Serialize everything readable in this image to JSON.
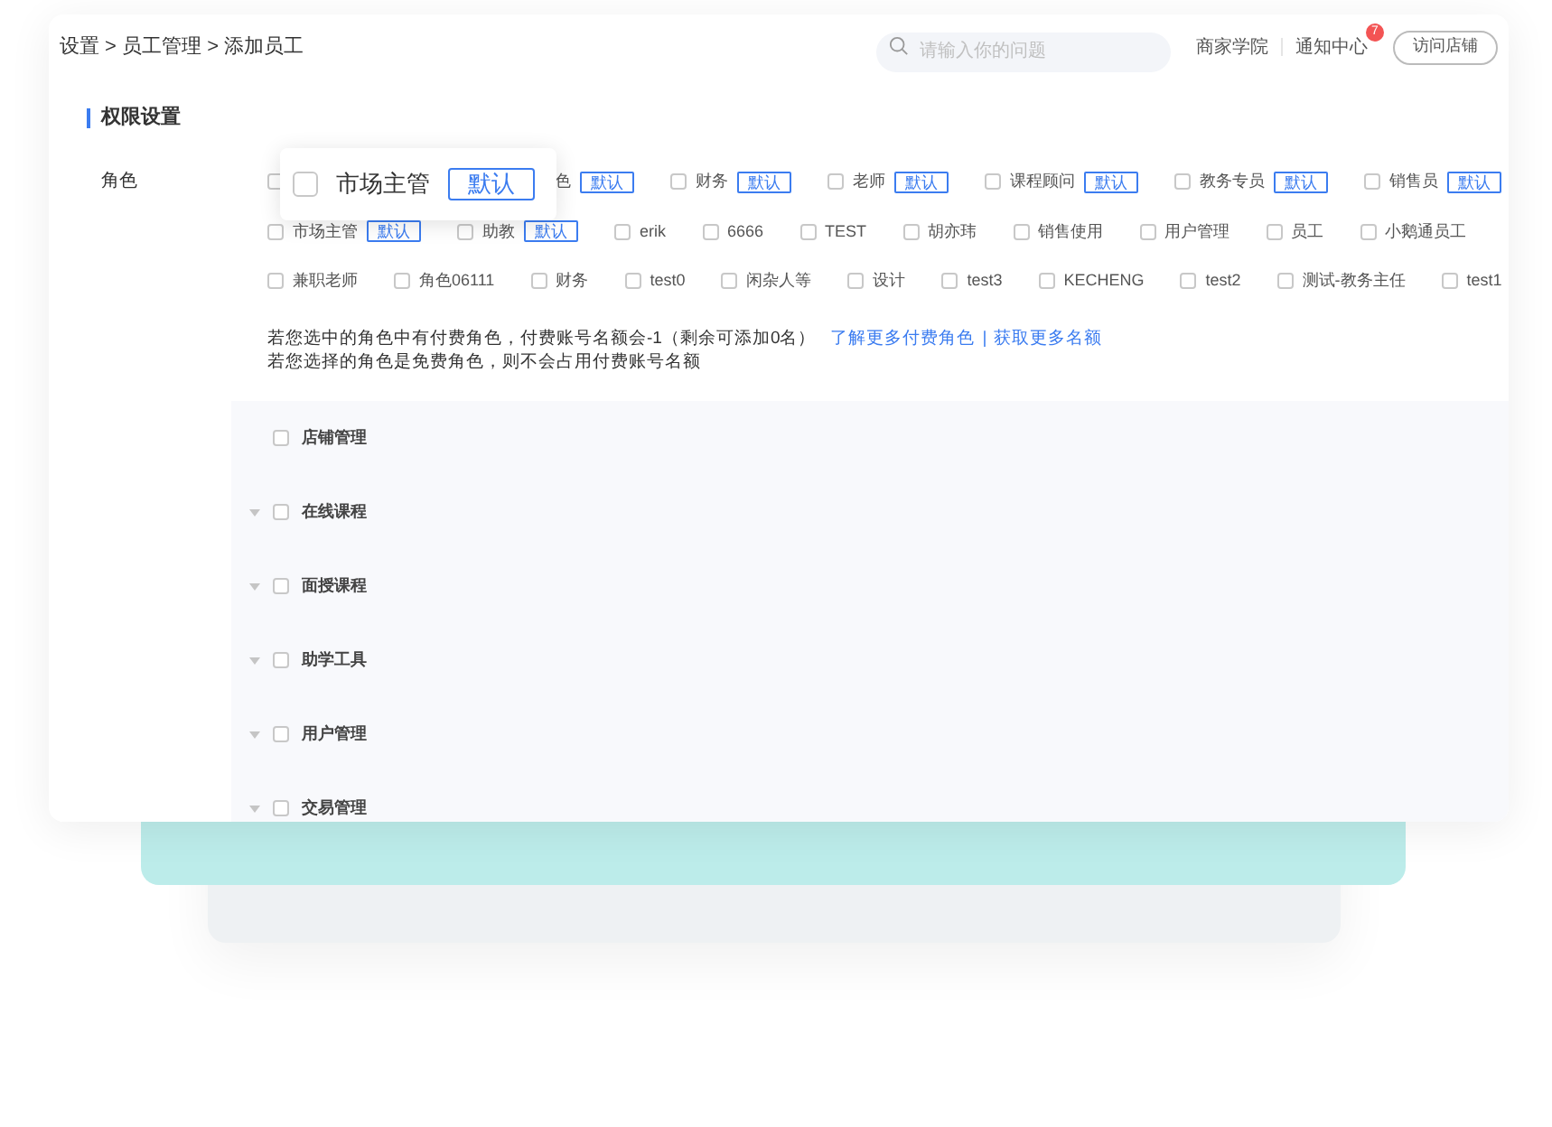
{
  "breadcrumb": "设置 > 员工管理 > 添加员工",
  "search": {
    "placeholder": "请输入你的问题"
  },
  "header_links": [
    {
      "label": "商家学院"
    },
    {
      "label": "通知中心",
      "badge": "7"
    }
  ],
  "visit_button": "访问店铺",
  "section_title": "权限设置",
  "role_label": "角色",
  "roles": [
    [
      {
        "label": "色",
        "tag": "默认"
      },
      {
        "label": "财务",
        "checked": false,
        "tag": "默认"
      },
      {
        "label": "老师",
        "checked": false,
        "tag": "默认"
      },
      {
        "label": "课程顾问",
        "checked": false,
        "tag": "默认"
      },
      {
        "label": "教务专员",
        "checked": false,
        "tag": "默认"
      },
      {
        "label": "销售员",
        "checked": false,
        "tag": "默认"
      }
    ],
    [
      {
        "label": "市场主管",
        "checked": false,
        "tag": "默认"
      },
      {
        "label": "助教",
        "checked": false,
        "tag": "默认"
      },
      {
        "label": "erik",
        "checked": false
      },
      {
        "label": "6666",
        "checked": false
      },
      {
        "label": "TEST",
        "checked": false
      },
      {
        "label": "胡亦玮",
        "checked": false
      },
      {
        "label": "销售使用",
        "checked": false
      },
      {
        "label": "用户管理",
        "checked": false
      },
      {
        "label": "员工",
        "checked": false
      },
      {
        "label": "小鹅通员工",
        "checked": false
      }
    ],
    [
      {
        "label": "兼职老师",
        "checked": false
      },
      {
        "label": "角色06111",
        "checked": false
      },
      {
        "label": "财务",
        "checked": false
      },
      {
        "label": "test0",
        "checked": false
      },
      {
        "label": "闲杂人等",
        "checked": false
      },
      {
        "label": "设计",
        "checked": false
      },
      {
        "label": "test3",
        "checked": false
      },
      {
        "label": "KECHENG",
        "checked": false
      },
      {
        "label": "test2",
        "checked": false
      },
      {
        "label": "测试-教务主任",
        "checked": false
      },
      {
        "label": "test1",
        "checked": false
      }
    ]
  ],
  "notice": {
    "line1": "若您选中的角色中有付费角色，付费账号名额会-1（剩余可添加0名）",
    "link1": "了解更多付费角色",
    "separator": "|",
    "link2": "获取更多名额",
    "line2": "若您选择的角色是免费角色，则不会占用付费账号名额"
  },
  "popup": {
    "label": "市场主管",
    "checked": false,
    "tag": "默认"
  },
  "permissions": [
    {
      "label": "店铺管理",
      "checked": false,
      "expandable": false
    },
    {
      "label": "在线课程",
      "checked": false,
      "expandable": true
    },
    {
      "label": "面授课程",
      "checked": false,
      "expandable": true
    },
    {
      "label": "助学工具",
      "checked": false,
      "expandable": true
    },
    {
      "label": "用户管理",
      "checked": false,
      "expandable": true
    },
    {
      "label": "交易管理",
      "checked": false,
      "expandable": true
    }
  ]
}
